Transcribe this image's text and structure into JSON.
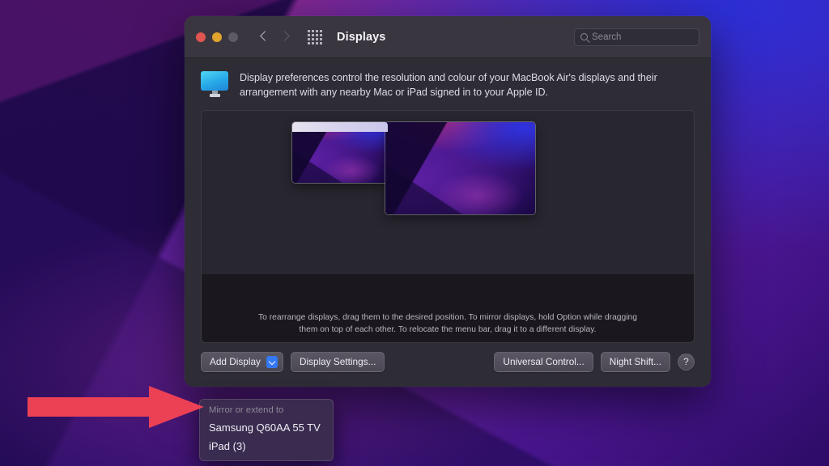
{
  "window": {
    "title": "Displays",
    "traffic_lights": [
      {
        "name": "close",
        "color": "#e0554f"
      },
      {
        "name": "minimize",
        "color": "#e0a32e"
      },
      {
        "name": "zoom",
        "color": "#5d5a63"
      }
    ],
    "nav": {
      "back_icon": "chevron-left-icon",
      "forward_icon": "chevron-right-icon",
      "grid_icon": "show-all-grid-icon"
    },
    "search": {
      "placeholder": "Search",
      "icon": "search-icon"
    }
  },
  "blurb": {
    "icon": "display-monitor-icon",
    "text": "Display preferences control the resolution and colour of your MacBook Air's displays and their arrangement with any nearby Mac or iPad signed in to your Apple ID."
  },
  "arrangement": {
    "displays": [
      {
        "id": "main",
        "name": "main-display-thumbnail",
        "has_menu_bar": true
      },
      {
        "id": "second",
        "name": "secondary-display-thumbnail",
        "has_menu_bar": false
      }
    ],
    "peripherals": [
      {
        "name": "magic-keyboard-illustration"
      },
      {
        "name": "magic-mouse-illustration"
      }
    ],
    "hint": "To rearrange displays, drag them to the desired position. To mirror displays, hold Option while dragging them on top of each other. To relocate the menu bar, drag it to a different display."
  },
  "buttons": {
    "add_display": "Add Display",
    "display_settings": "Display Settings...",
    "universal_control": "Universal Control...",
    "night_shift": "Night Shift...",
    "help": "?"
  },
  "add_display_menu": {
    "header": "Mirror or extend to",
    "items": [
      {
        "label": "Samsung Q60AA 55 TV"
      },
      {
        "label": "iPad (3)"
      }
    ]
  },
  "annotation": {
    "arrow_color": "#ec4055",
    "arrow_direction": "right"
  },
  "colors": {
    "window_body": "#2e2c35",
    "titlebar": "#39363f",
    "panel": "#282630",
    "desk_band": "#1a181e",
    "accent_blue": "#3478f6",
    "menu_bg": "#3a2c4e"
  }
}
